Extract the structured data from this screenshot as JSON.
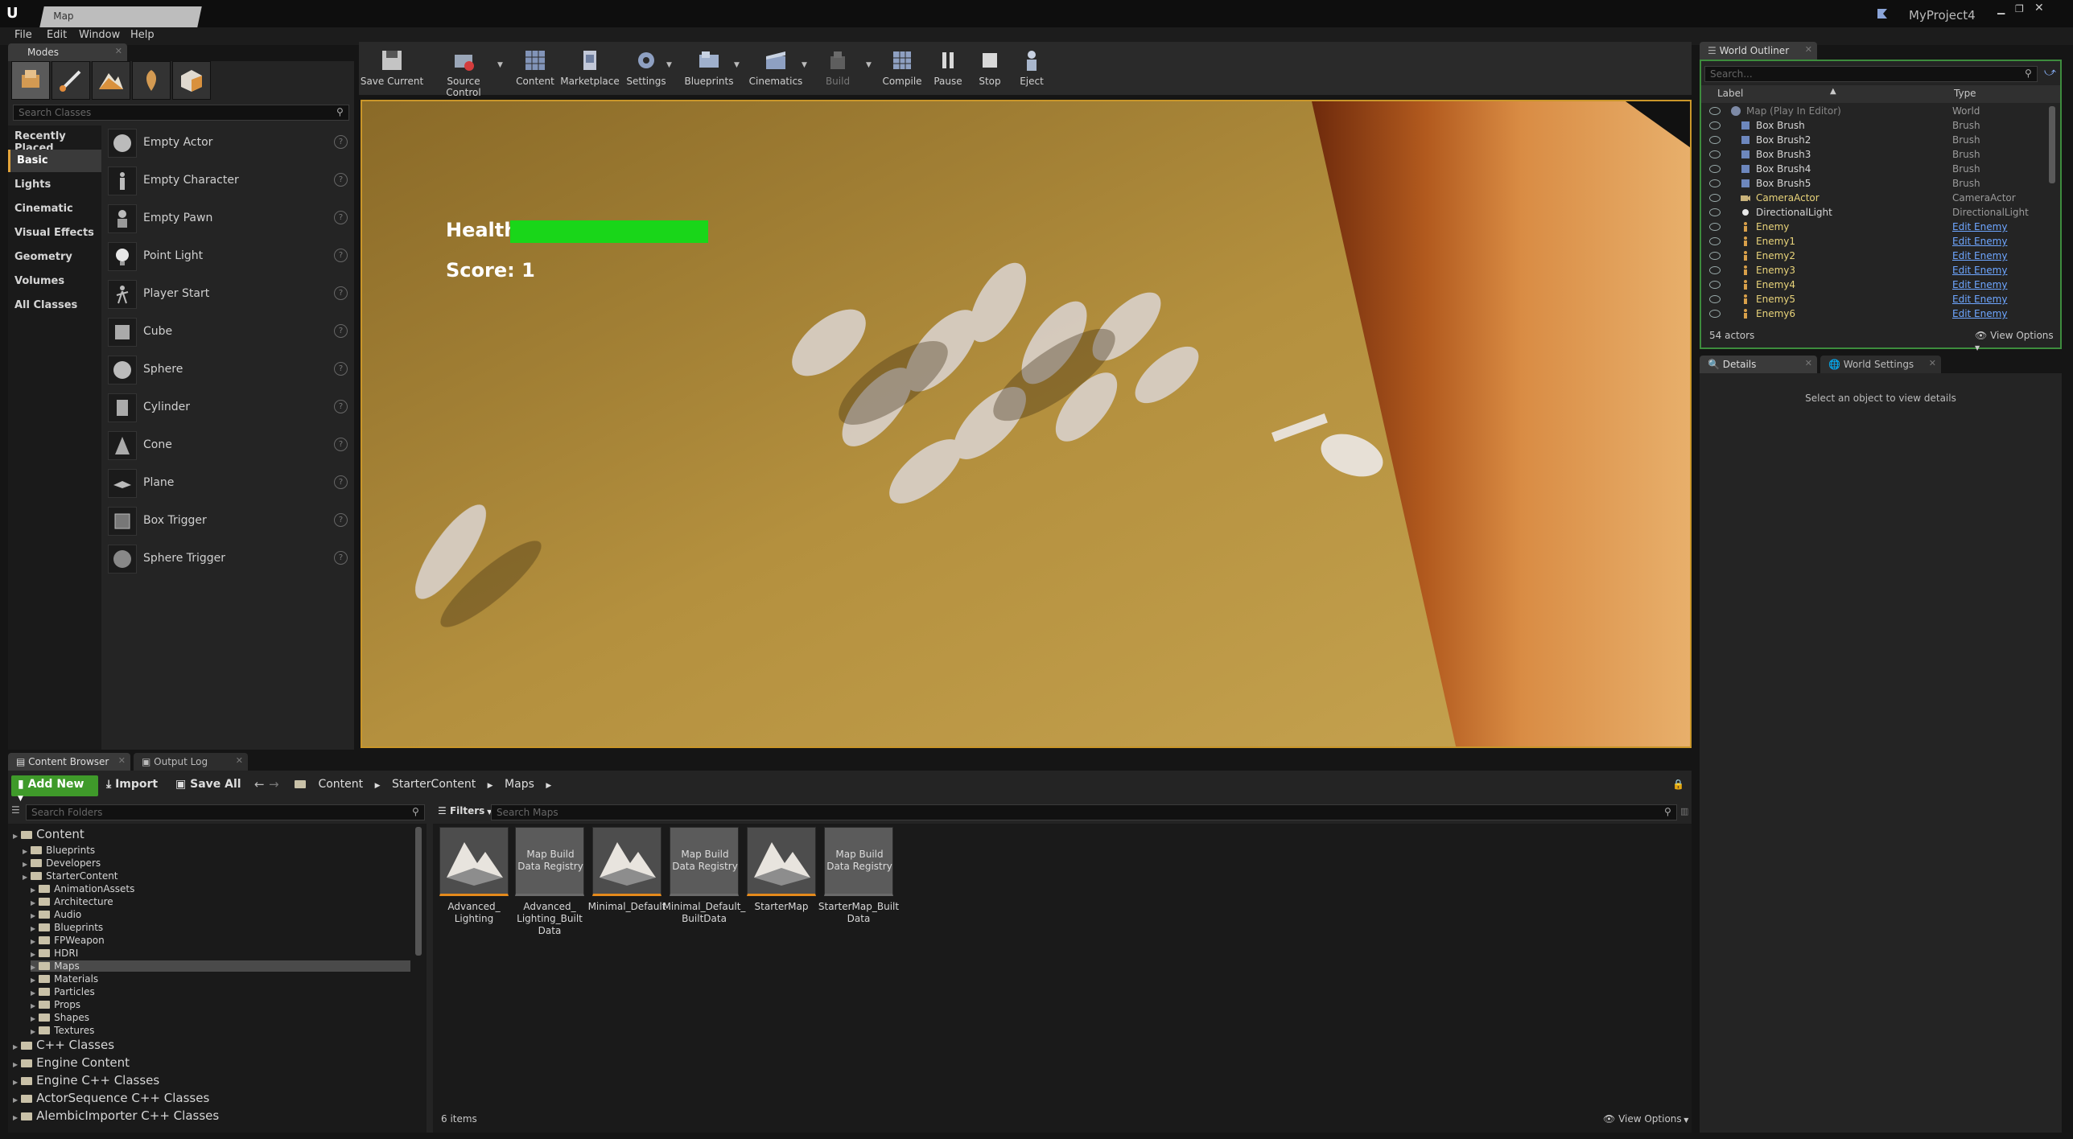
{
  "window": {
    "tab_title": "Map",
    "project_name": "MyProject4"
  },
  "menu": [
    "File",
    "Edit",
    "Window",
    "Help"
  ],
  "modes": {
    "tab": "Modes",
    "search_placeholder": "Search Classes",
    "categories": [
      "Recently Placed",
      "Basic",
      "Lights",
      "Cinematic",
      "Visual Effects",
      "Geometry",
      "Volumes",
      "All Classes"
    ],
    "selected_category": "Basic",
    "items": [
      "Empty Actor",
      "Empty Character",
      "Empty Pawn",
      "Point Light",
      "Player Start",
      "Cube",
      "Sphere",
      "Cylinder",
      "Cone",
      "Plane",
      "Box Trigger",
      "Sphere Trigger"
    ]
  },
  "toolbar": [
    "Save Current",
    "Source Control",
    "Content",
    "Marketplace",
    "Settings",
    "Blueprints",
    "Cinematics",
    "Build",
    "Compile",
    "Pause",
    "Stop",
    "Eject"
  ],
  "hud": {
    "health_label": "Health:",
    "health_value": 1.0,
    "score_label": "Score: 1"
  },
  "outliner": {
    "tab": "World Outliner",
    "search_placeholder": "Search...",
    "col_label": "Label",
    "col_type": "Type",
    "rows": [
      {
        "name": "Map (Play In Editor)",
        "type": "World"
      },
      {
        "name": "Box Brush",
        "type": "Brush"
      },
      {
        "name": "Box Brush2",
        "type": "Brush"
      },
      {
        "name": "Box Brush3",
        "type": "Brush"
      },
      {
        "name": "Box Brush4",
        "type": "Brush"
      },
      {
        "name": "Box Brush5",
        "type": "Brush"
      },
      {
        "name": "CameraActor",
        "type": "CameraActor"
      },
      {
        "name": "DirectionalLight",
        "type": "DirectionalLight"
      },
      {
        "name": "Enemy",
        "type": "Edit Enemy"
      },
      {
        "name": "Enemy1",
        "type": "Edit Enemy"
      },
      {
        "name": "Enemy2",
        "type": "Edit Enemy"
      },
      {
        "name": "Enemy3",
        "type": "Edit Enemy"
      },
      {
        "name": "Enemy4",
        "type": "Edit Enemy"
      },
      {
        "name": "Enemy5",
        "type": "Edit Enemy"
      },
      {
        "name": "Enemy6",
        "type": "Edit Enemy"
      }
    ],
    "actor_count": "54 actors",
    "view_options": "View Options"
  },
  "details": {
    "tab_details": "Details",
    "tab_world_settings": "World Settings",
    "empty_text": "Select an object to view details"
  },
  "content_browser": {
    "tab": "Content Browser",
    "tab_output": "Output Log",
    "add_new": "Add New",
    "import": "Import",
    "save_all": "Save All",
    "path": [
      "Content",
      "StarterContent",
      "Maps"
    ],
    "search_folders": "Search Folders",
    "filters": "Filters",
    "search_maps": "Search Maps",
    "tree": [
      {
        "label": "Content",
        "level": 0,
        "big": true
      },
      {
        "label": "Blueprints",
        "level": 1
      },
      {
        "label": "Developers",
        "level": 1
      },
      {
        "label": "StarterContent",
        "level": 1
      },
      {
        "label": "AnimationAssets",
        "level": 2
      },
      {
        "label": "Architecture",
        "level": 2
      },
      {
        "label": "Audio",
        "level": 2
      },
      {
        "label": "Blueprints",
        "level": 2
      },
      {
        "label": "FPWeapon",
        "level": 2
      },
      {
        "label": "HDRI",
        "level": 2
      },
      {
        "label": "Maps",
        "level": 2,
        "selected": true
      },
      {
        "label": "Materials",
        "level": 2
      },
      {
        "label": "Particles",
        "level": 2
      },
      {
        "label": "Props",
        "level": 2
      },
      {
        "label": "Shapes",
        "level": 2
      },
      {
        "label": "Textures",
        "level": 2
      },
      {
        "label": "C++ Classes",
        "level": 0,
        "big": true
      },
      {
        "label": "Engine Content",
        "level": 0,
        "big": true
      },
      {
        "label": "Engine C++ Classes",
        "level": 0,
        "big": true
      },
      {
        "label": "ActorSequence C++ Classes",
        "level": 0,
        "big": true
      },
      {
        "label": "AlembicImporter C++ Classes",
        "level": 0,
        "big": true
      }
    ],
    "assets": [
      {
        "name": "Advanced_ Lighting",
        "kind": "map"
      },
      {
        "name": "Advanced_ Lighting_Built Data",
        "kind": "registry",
        "tile_text": "Map Build Data Registry"
      },
      {
        "name": "Minimal_Default",
        "kind": "map"
      },
      {
        "name": "Minimal_Default_ BuiltData",
        "kind": "registry",
        "tile_text": "Map Build Data Registry"
      },
      {
        "name": "StarterMap",
        "kind": "map"
      },
      {
        "name": "StarterMap_Built Data",
        "kind": "registry",
        "tile_text": "Map Build Data Registry"
      }
    ],
    "item_count": "6 items",
    "view_options": "View Options"
  }
}
